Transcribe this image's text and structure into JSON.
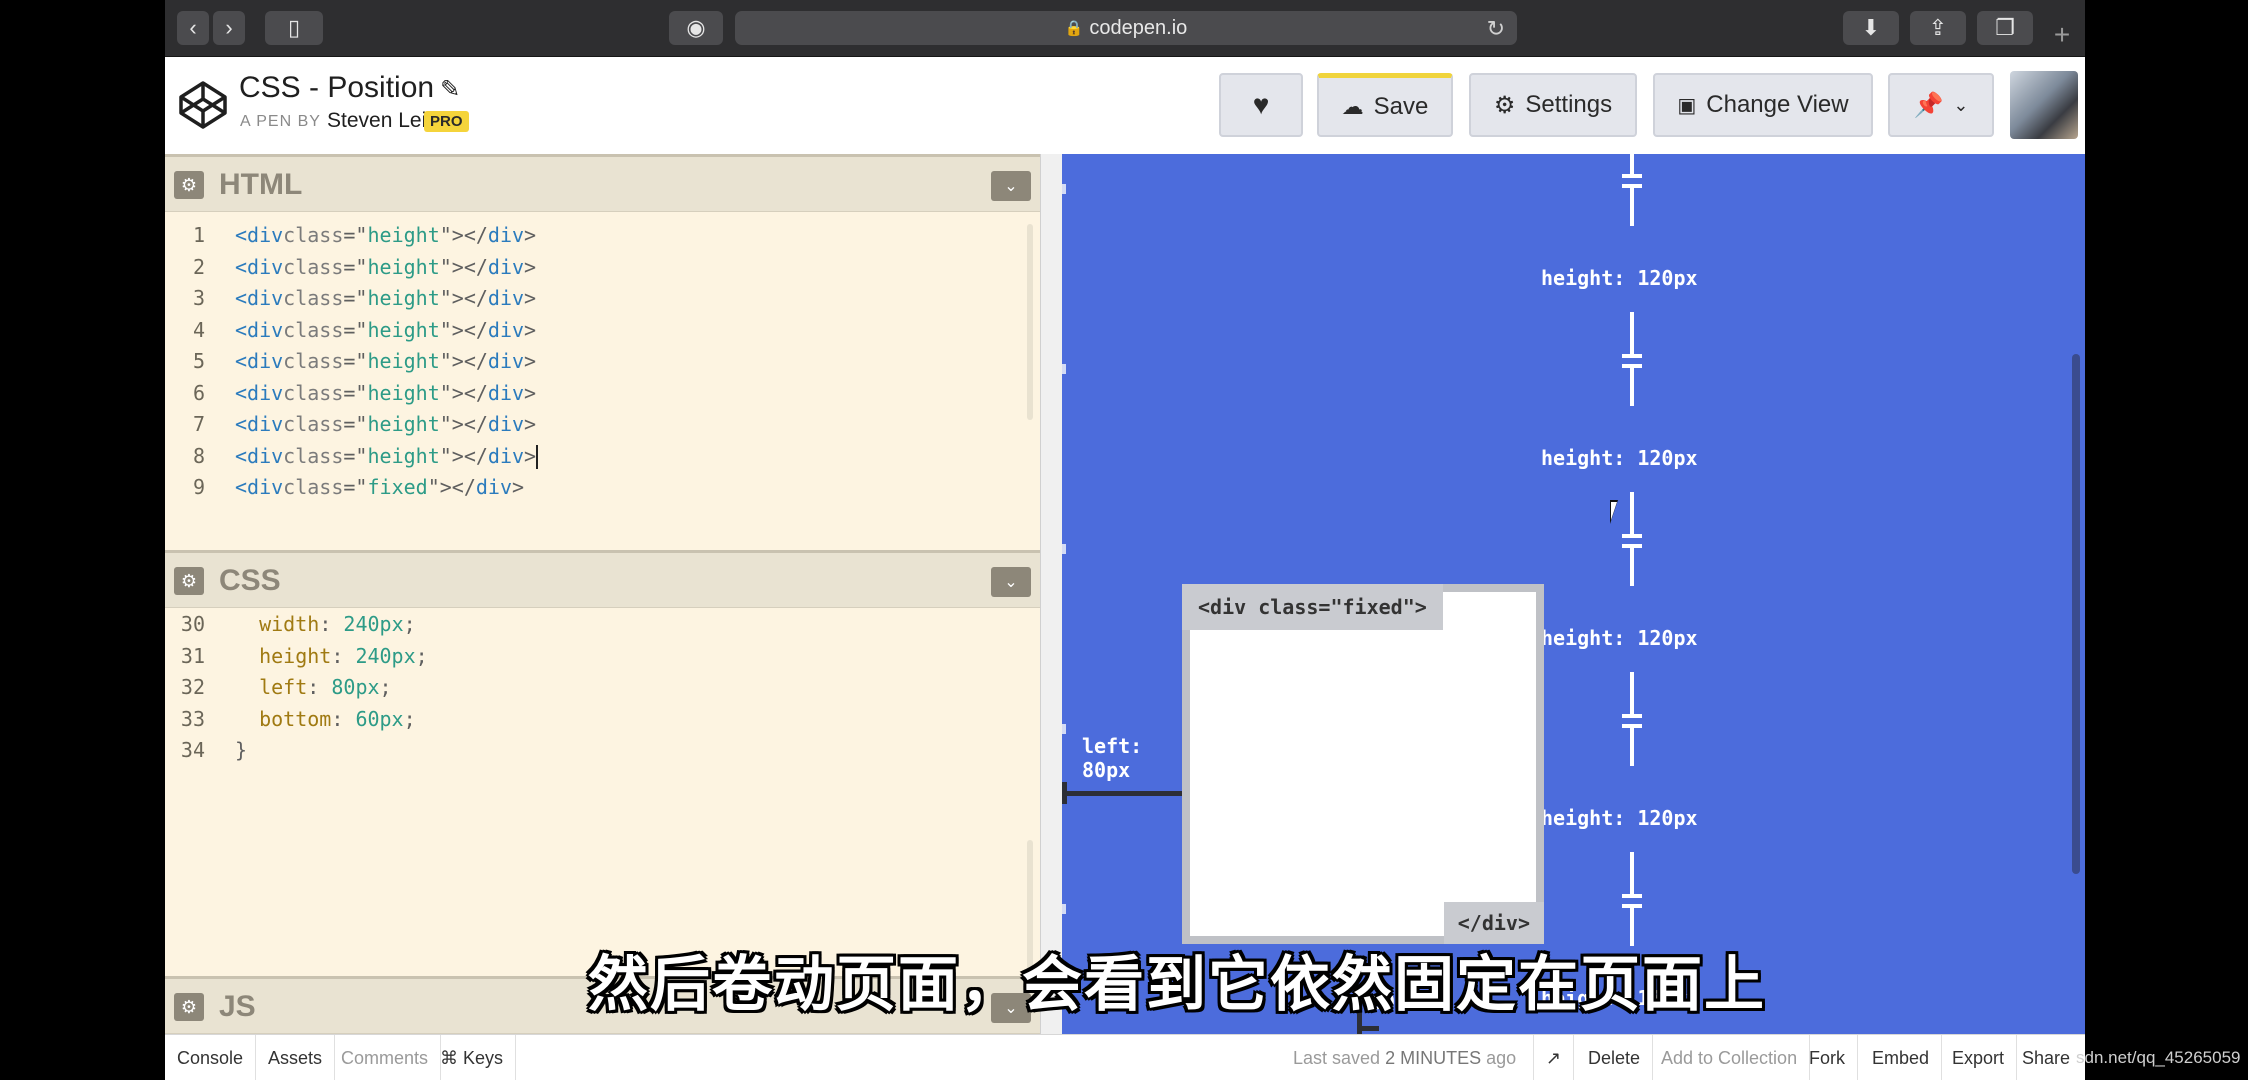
{
  "browser": {
    "url": "codepen.io",
    "new_tab": "+"
  },
  "header": {
    "title": "CSS - Position",
    "by_label": "A PEN BY",
    "author": "Steven Lei",
    "badge": "PRO",
    "save_label": "Save",
    "settings_label": "Settings",
    "change_view_label": "Change View"
  },
  "html_pane": {
    "name": "HTML",
    "lines": [
      {
        "n": "1",
        "cls": "height"
      },
      {
        "n": "2",
        "cls": "height"
      },
      {
        "n": "3",
        "cls": "height"
      },
      {
        "n": "4",
        "cls": "height"
      },
      {
        "n": "5",
        "cls": "height"
      },
      {
        "n": "6",
        "cls": "height"
      },
      {
        "n": "7",
        "cls": "height"
      },
      {
        "n": "8",
        "cls": "height"
      },
      {
        "n": "9",
        "cls": "fixed"
      }
    ]
  },
  "css_pane": {
    "name": "CSS",
    "lines": [
      {
        "n": "30",
        "prop": "width",
        "val": "240px"
      },
      {
        "n": "31",
        "prop": "height",
        "val": "240px"
      },
      {
        "n": "32",
        "prop": "left",
        "val": "80px"
      },
      {
        "n": "33",
        "prop": "bottom",
        "val": "60px"
      },
      {
        "n": "34",
        "close": "}"
      }
    ]
  },
  "js_pane": {
    "name": "JS"
  },
  "preview": {
    "height_label": "height: 120px",
    "fixed_open_tag": "<div class=\"fixed\">",
    "fixed_close_tag": "</div>",
    "left_label_line1": "left:",
    "left_label_line2": "80px",
    "bottom_label": "60px"
  },
  "footer": {
    "console": "Console",
    "assets": "Assets",
    "comments": "Comments",
    "keys": "⌘ Keys",
    "last_saved_prefix": "Last saved",
    "last_saved_time": "2 MINUTES",
    "last_saved_suffix": "ago",
    "delete": "Delete",
    "add_to_collection": "Add to Collection",
    "fork": "Fork",
    "embed": "Embed",
    "export": "Export",
    "share": "Share"
  },
  "subtitle": "然后卷动页面，会看到它依然固定在页面上",
  "watermark": "sdn.net/qq_45265059"
}
